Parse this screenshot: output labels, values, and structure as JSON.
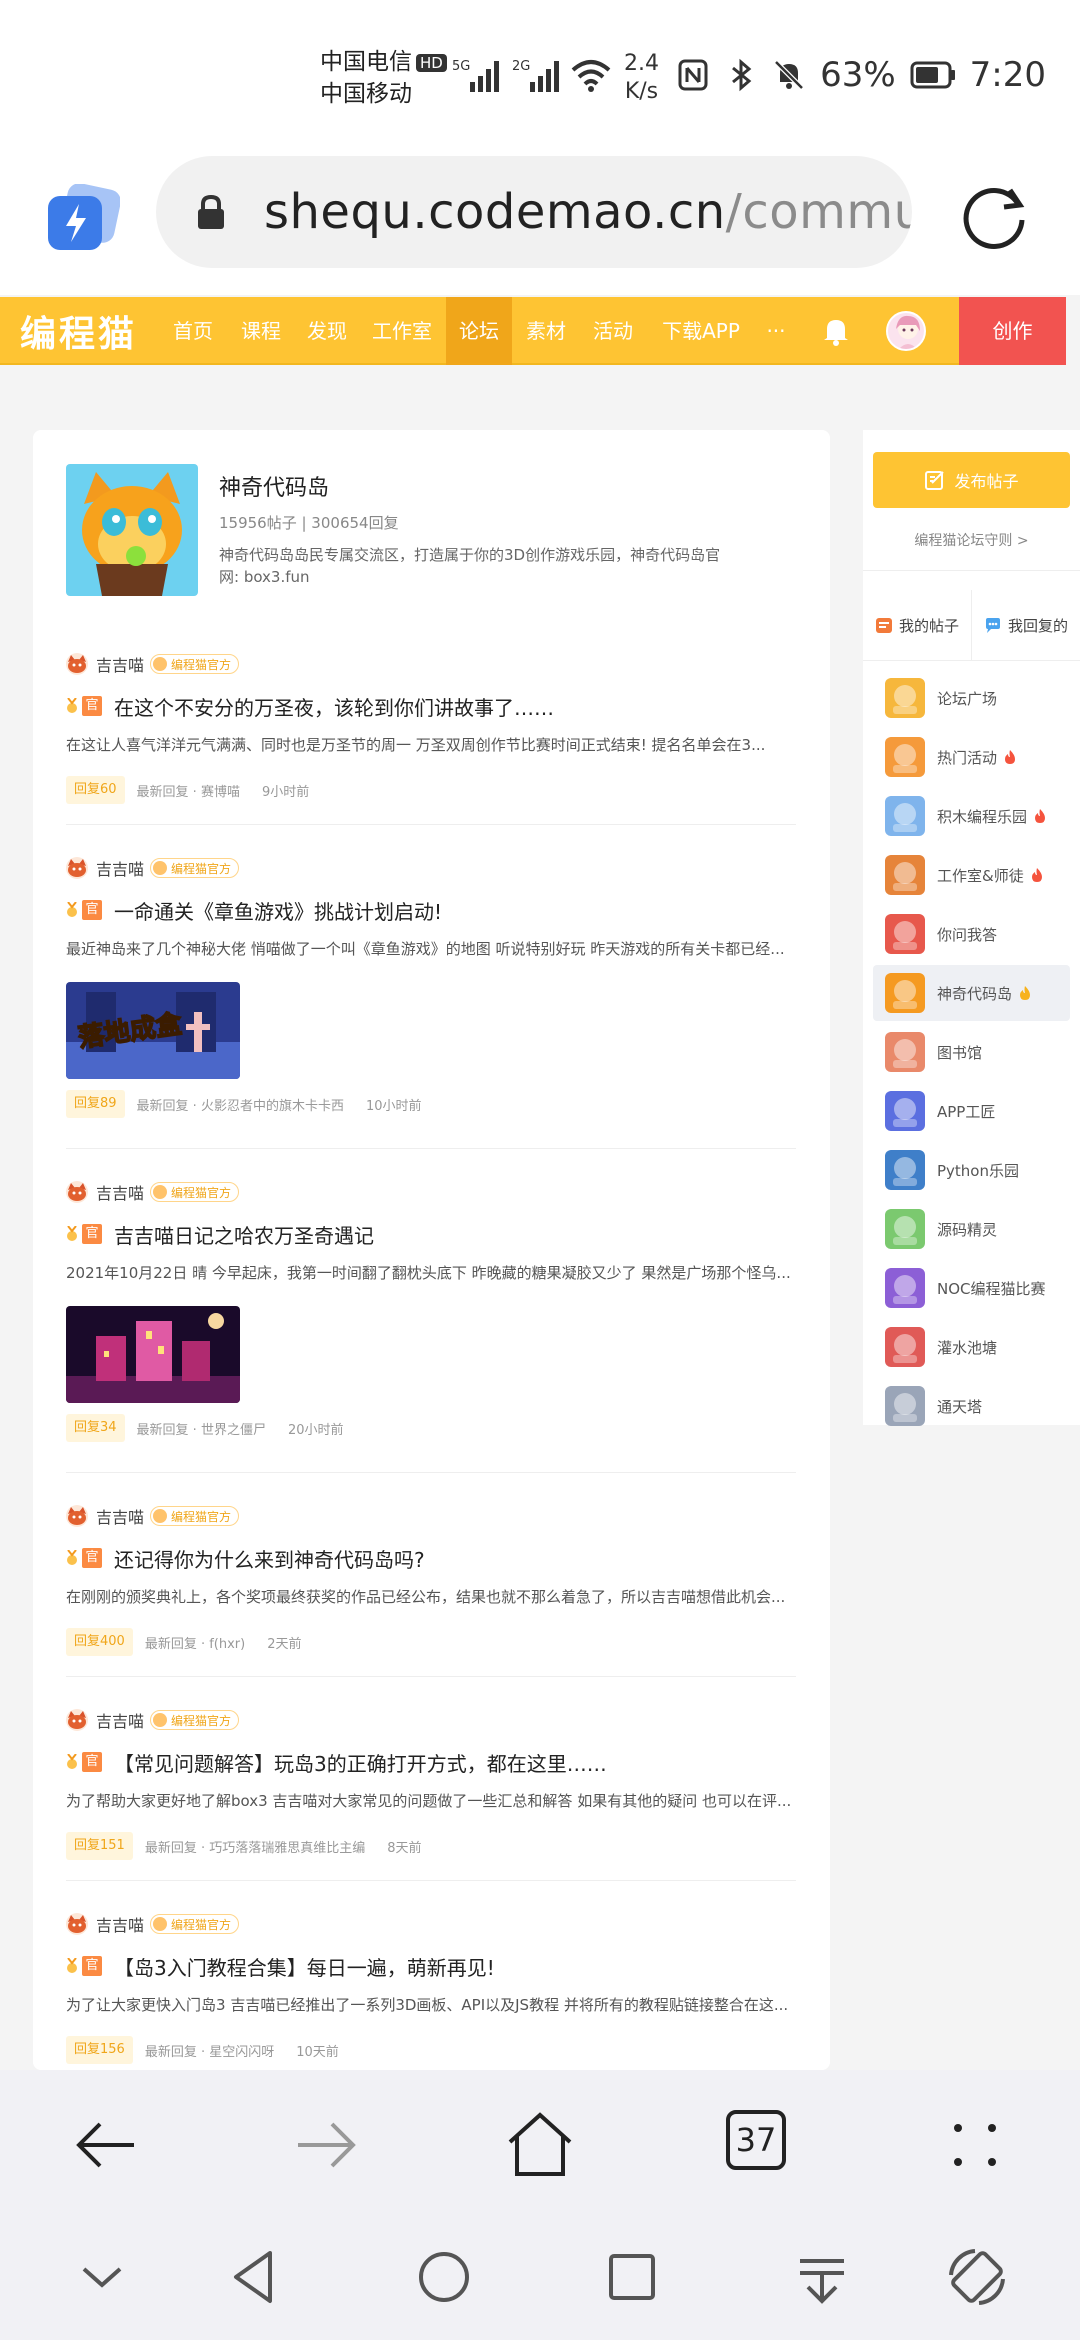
{
  "status": {
    "carrier1": "中国电信",
    "hd": "HD",
    "carrier2": "中国移动",
    "signal1": "5G",
    "signal2": "2G",
    "speed_value": "2.4",
    "speed_unit": "K/s",
    "battery": "63%",
    "time": "7:20"
  },
  "browser": {
    "url_main": "shequ.codemao.cn",
    "url_rest": "/communi",
    "tab_count": "37"
  },
  "nav": {
    "logo": "编程猫",
    "items": [
      "首页",
      "课程",
      "发现",
      "工作室",
      "论坛",
      "素材",
      "活动",
      "下载APP",
      "···"
    ],
    "active_index": 4,
    "create": "创作"
  },
  "forum": {
    "title": "神奇代码岛",
    "stats": "15956帖子 | 300654回复",
    "desc": "神奇代码岛岛民专属交流区，打造属于你的3D创作游戏乐园，神奇代码岛官网: box3.fun"
  },
  "posts": [
    {
      "user": "吉吉喵",
      "badge": "编程猫官方",
      "tag": "官",
      "title": "在这个不安分的万圣夜，该轮到你们讲故事了……",
      "excerpt": "在这让人喜气洋洋元气满满、同时也是万圣节的周一 万圣双周创作节比赛时间正式结束!   提名名单会在3...",
      "reply": "回复60",
      "latest": "最新回复 · 赛博喵",
      "time": "9小时前"
    },
    {
      "user": "吉吉喵",
      "badge": "编程猫官方",
      "tag": "官",
      "title": "一命通关《章鱼游戏》挑战计划启动!",
      "excerpt": "最近神岛来了几个神秘大佬 悄喵做了一个叫《章鱼游戏》的地图 听说特别好玩 昨天游戏的所有关卡都已经...",
      "reply": "回复89",
      "latest": "最新回复 · 火影忍者中的旗木卡卡西",
      "time": "10小时前"
    },
    {
      "user": "吉吉喵",
      "badge": "编程猫官方",
      "tag": "官",
      "title": "吉吉喵日记之哈农万圣奇遇记",
      "excerpt": "2021年10月22日 晴 今早起床，我第一时间翻了翻枕头底下 昨晚藏的糖果凝胶又少了 果然是广场那个怪乌...",
      "reply": "回复34",
      "latest": "最新回复 · 世界之僵尸",
      "time": "20小时前"
    },
    {
      "user": "吉吉喵",
      "badge": "编程猫官方",
      "tag": "官",
      "title": "还记得你为什么来到神奇代码岛吗?",
      "excerpt": "在刚刚的颁奖典礼上，各个奖项最终获奖的作品已经公布，结果也就不那么着急了，所以吉吉喵想借此机会...",
      "reply": "回复400",
      "latest": "最新回复 · f(hxr)",
      "time": "2天前"
    },
    {
      "user": "吉吉喵",
      "badge": "编程猫官方",
      "tag": "官",
      "title": "【常见问题解答】玩岛3的正确打开方式，都在这里……",
      "excerpt": "为了帮助大家更好地了解box3 吉吉喵对大家常见的问题做了一些汇总和解答 如果有其他的疑问 也可以在评...",
      "reply": "回复151",
      "latest": "最新回复 · 巧巧落落瑞雅思真维比主编",
      "time": "8天前"
    },
    {
      "user": "吉吉喵",
      "badge": "编程猫官方",
      "tag": "官",
      "title": "【岛3入门教程合集】每日一遍，萌新再见!",
      "excerpt": "为了让大家更快入门岛3 吉吉喵已经推出了一系列3D画板、API以及JS教程 并将所有的教程贴链接整合在这...",
      "reply": "回复156",
      "latest": "最新回复 · 星空闪闪呀",
      "time": "10天前"
    }
  ],
  "side": {
    "post_button": "发布帖子",
    "rules": "编程猫论坛守则 >",
    "my_posts": "我的帖子",
    "my_replies": "我回复的",
    "boards": [
      {
        "label": "论坛广场",
        "hot": false,
        "color": "#f6b73c"
      },
      {
        "label": "热门活动",
        "hot": true,
        "color": "#f59a3b"
      },
      {
        "label": "积木编程乐园",
        "hot": true,
        "color": "#7fb4ec"
      },
      {
        "label": "工作室&师徒",
        "hot": true,
        "color": "#e6843a"
      },
      {
        "label": "你问我答",
        "hot": false,
        "color": "#e7584c"
      },
      {
        "label": "神奇代码岛",
        "hot": false,
        "color": "#f59a21"
      },
      {
        "label": "图书馆",
        "hot": false,
        "color": "#e9896a"
      },
      {
        "label": "APP工匠",
        "hot": false,
        "color": "#5b6fe0"
      },
      {
        "label": "Python乐园",
        "hot": false,
        "color": "#3f7fc9"
      },
      {
        "label": "源码精灵",
        "hot": false,
        "color": "#7bc96f"
      },
      {
        "label": "NOC编程猫比赛",
        "hot": false,
        "color": "#8c5fd6"
      },
      {
        "label": "灌水池塘",
        "hot": false,
        "color": "#e05a57"
      },
      {
        "label": "通天塔",
        "hot": false,
        "color": "#9aa5b8"
      }
    ],
    "active_board": "神奇代码岛"
  }
}
